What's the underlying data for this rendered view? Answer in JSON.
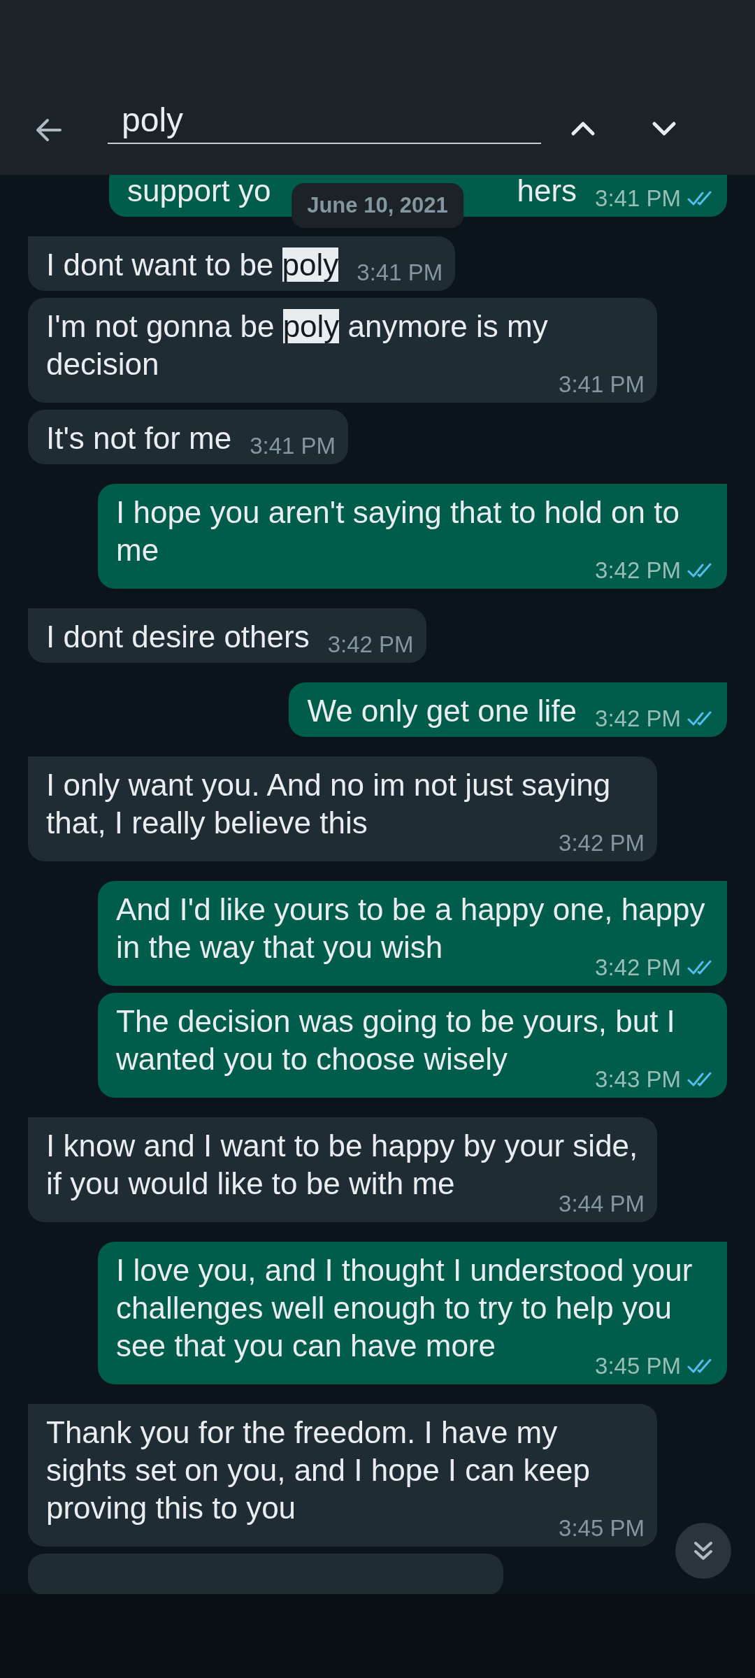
{
  "search": {
    "value": "poly"
  },
  "date_chip": "June 10, 2021",
  "messages": [
    {
      "kind": "outgoing",
      "parts": [
        {
          "kind": "text",
          "text": "support yo"
        },
        {
          "kind": "covered"
        },
        {
          "kind": "text",
          "text": "hers"
        }
      ],
      "time": "3:41 PM",
      "read": true
    },
    {
      "kind": "incoming",
      "parts": [
        {
          "kind": "text",
          "text": "I dont want to be "
        },
        {
          "kind": "match",
          "text": "poly"
        }
      ],
      "time": "3:41 PM"
    },
    {
      "kind": "incoming",
      "parts": [
        {
          "kind": "text",
          "text": "I'm not gonna be "
        },
        {
          "kind": "match",
          "text": "poly"
        },
        {
          "kind": "text",
          "text": " anymore is my decision"
        }
      ],
      "time": "3:41 PM"
    },
    {
      "kind": "incoming",
      "parts": [
        {
          "kind": "text",
          "text": "It's not for me"
        }
      ],
      "time": "3:41 PM"
    },
    {
      "kind": "outgoing",
      "parts": [
        {
          "kind": "text",
          "text": "I hope you aren't saying that to hold on to me"
        }
      ],
      "time": "3:42 PM",
      "read": true
    },
    {
      "kind": "incoming",
      "parts": [
        {
          "kind": "text",
          "text": "I dont desire others"
        }
      ],
      "time": "3:42 PM"
    },
    {
      "kind": "outgoing",
      "parts": [
        {
          "kind": "text",
          "text": "We only get one life"
        }
      ],
      "time": "3:42 PM",
      "read": true
    },
    {
      "kind": "incoming",
      "parts": [
        {
          "kind": "text",
          "text": "I only want you. And no im not just saying that, I really believe this"
        }
      ],
      "time": "3:42 PM"
    },
    {
      "kind": "outgoing",
      "parts": [
        {
          "kind": "text",
          "text": "And I'd like yours to be a happy one, happy in the way that you wish"
        }
      ],
      "time": "3:42 PM",
      "read": true
    },
    {
      "kind": "outgoing",
      "parts": [
        {
          "kind": "text",
          "text": "The decision was going to be yours, but I wanted you to choose wisely"
        }
      ],
      "time": "3:43 PM",
      "read": true
    },
    {
      "kind": "incoming",
      "parts": [
        {
          "kind": "text",
          "text": "I know and I want to be happy by your side, if you would like to be with me"
        }
      ],
      "time": "3:44 PM"
    },
    {
      "kind": "outgoing",
      "parts": [
        {
          "kind": "text",
          "text": "I love you, and I thought I understood your challenges well enough to try to help you see that you can have more"
        }
      ],
      "time": "3:45 PM",
      "read": true
    },
    {
      "kind": "incoming",
      "parts": [
        {
          "kind": "text",
          "text": "Thank you for the freedom. I have my sights set on you, and I hope I can keep proving this to you"
        }
      ],
      "time": "3:45 PM"
    },
    {
      "kind": "partial"
    }
  ]
}
